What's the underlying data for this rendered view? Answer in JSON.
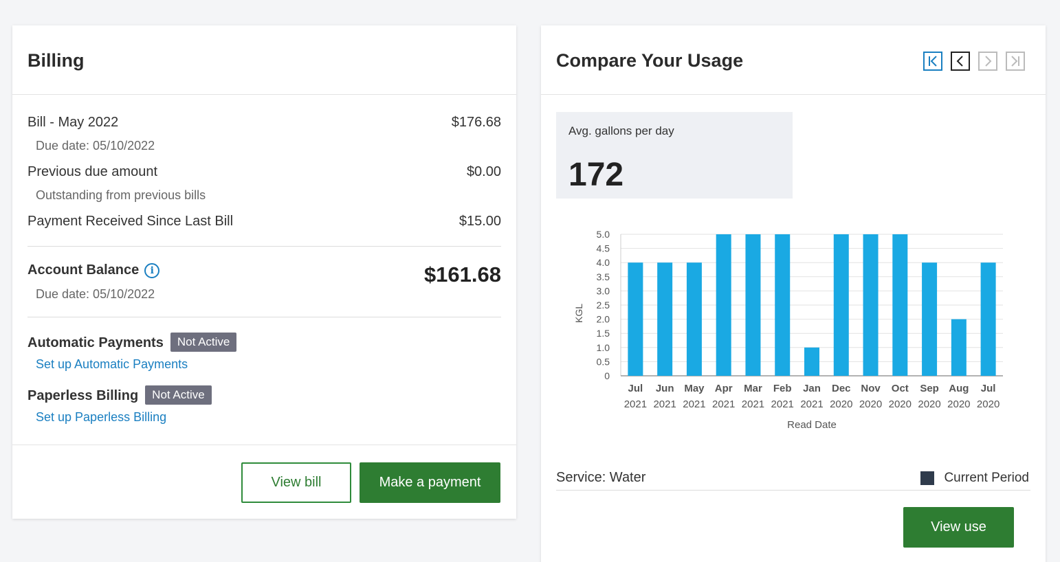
{
  "billing": {
    "title": "Billing",
    "bill": {
      "label": "Bill - May 2022",
      "value": "$176.68",
      "sub": "Due date: 05/10/2022"
    },
    "previous": {
      "label": "Previous due amount",
      "value": "$0.00",
      "sub": "Outstanding from previous bills"
    },
    "payment_received": {
      "label": "Payment Received Since Last Bill",
      "value": "$15.00"
    },
    "balance": {
      "label": "Account Balance",
      "info_icon": "info-icon",
      "value": "$161.68",
      "sub": "Due date: 05/10/2022"
    },
    "auto_payments": {
      "label": "Automatic Payments",
      "status": "Not Active",
      "link": "Set up Automatic Payments"
    },
    "paperless": {
      "label": "Paperless Billing",
      "status": "Not Active",
      "link": "Set up Paperless Billing"
    },
    "buttons": {
      "view_bill": "View bill",
      "make_payment": "Make a payment"
    }
  },
  "usage": {
    "title": "Compare Your Usage",
    "pager_icons": [
      "first-page-icon",
      "prev-page-icon",
      "next-page-icon",
      "last-page-icon"
    ],
    "avg_label": "Avg. gallons per day",
    "avg_value": "172",
    "service_label": "Service: Water",
    "legend_label": "Current Period",
    "view_use": "View use"
  },
  "colors": {
    "bar": "#1aa9e3",
    "green": "#2e7d32",
    "link": "#1a7fc1",
    "badge": "#6e6f7e",
    "legend": "#2f3b4c"
  },
  "chart_data": {
    "type": "bar",
    "categories": [
      [
        "Jul",
        "2021"
      ],
      [
        "Jun",
        "2021"
      ],
      [
        "May",
        "2021"
      ],
      [
        "Apr",
        "2021"
      ],
      [
        "Mar",
        "2021"
      ],
      [
        "Feb",
        "2021"
      ],
      [
        "Jan",
        "2021"
      ],
      [
        "Dec",
        "2020"
      ],
      [
        "Nov",
        "2020"
      ],
      [
        "Oct",
        "2020"
      ],
      [
        "Sep",
        "2020"
      ],
      [
        "Aug",
        "2020"
      ],
      [
        "Jul",
        "2020"
      ]
    ],
    "values": [
      4,
      4,
      4,
      5,
      5,
      5,
      1,
      5,
      5,
      5,
      4,
      2,
      4
    ],
    "yticks": [
      "0",
      "0.5",
      "1.0",
      "1.5",
      "2.0",
      "2.5",
      "3.0",
      "3.5",
      "4.0",
      "4.5",
      "5.0"
    ],
    "ylim": [
      0,
      5
    ],
    "xlabel": "Read Date",
    "ylabel": "KGL",
    "grid": true
  }
}
